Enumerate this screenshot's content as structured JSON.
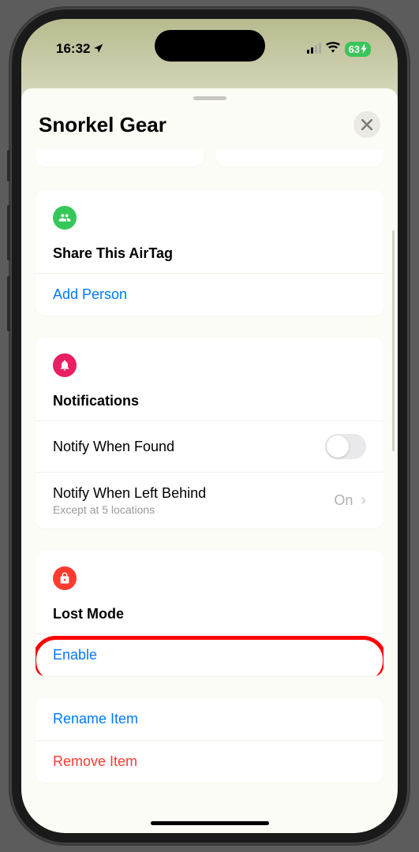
{
  "status": {
    "time": "16:32",
    "battery": "63"
  },
  "sheet": {
    "title": "Snorkel Gear"
  },
  "share": {
    "title": "Share This AirTag",
    "add_person": "Add Person"
  },
  "notifications": {
    "title": "Notifications",
    "notify_found": "Notify When Found",
    "notify_left": "Notify When Left Behind",
    "notify_left_sub": "Except at 5 locations",
    "notify_left_value": "On"
  },
  "lost_mode": {
    "title": "Lost Mode",
    "enable": "Enable"
  },
  "actions": {
    "rename": "Rename Item",
    "remove": "Remove Item"
  }
}
